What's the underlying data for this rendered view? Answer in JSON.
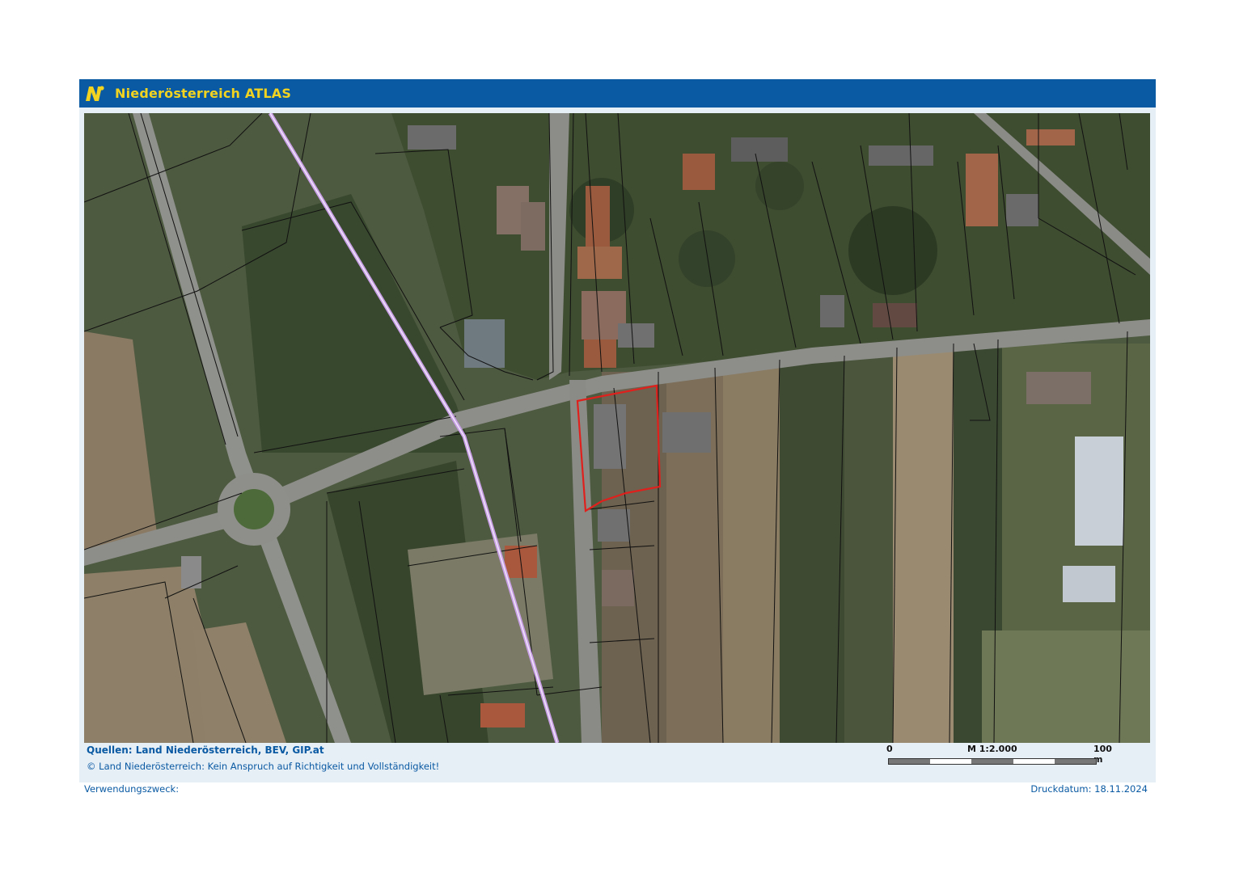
{
  "header": {
    "title": "Niederösterreich ATLAS",
    "logo_letter": "N",
    "bar_color": "#0a5aa3",
    "title_color": "#f2d31f"
  },
  "map": {
    "parcel_line_color": "#111111",
    "highlight_color": "#e0201c",
    "powerline_color": "#c9a0e6"
  },
  "footer": {
    "sources": "Quellen: Land Niederösterreich, BEV, GIP.at",
    "copyright": "© Land Niederösterreich: Kein Anspruch auf Richtigkeit und Vollständigkeit!",
    "usage_label": "Verwendungszweck:",
    "print_date": "Druckdatum: 18.11.2024"
  },
  "scale": {
    "start_label": "0",
    "scale_label": "M 1:2.000",
    "end_label": "100 m"
  }
}
